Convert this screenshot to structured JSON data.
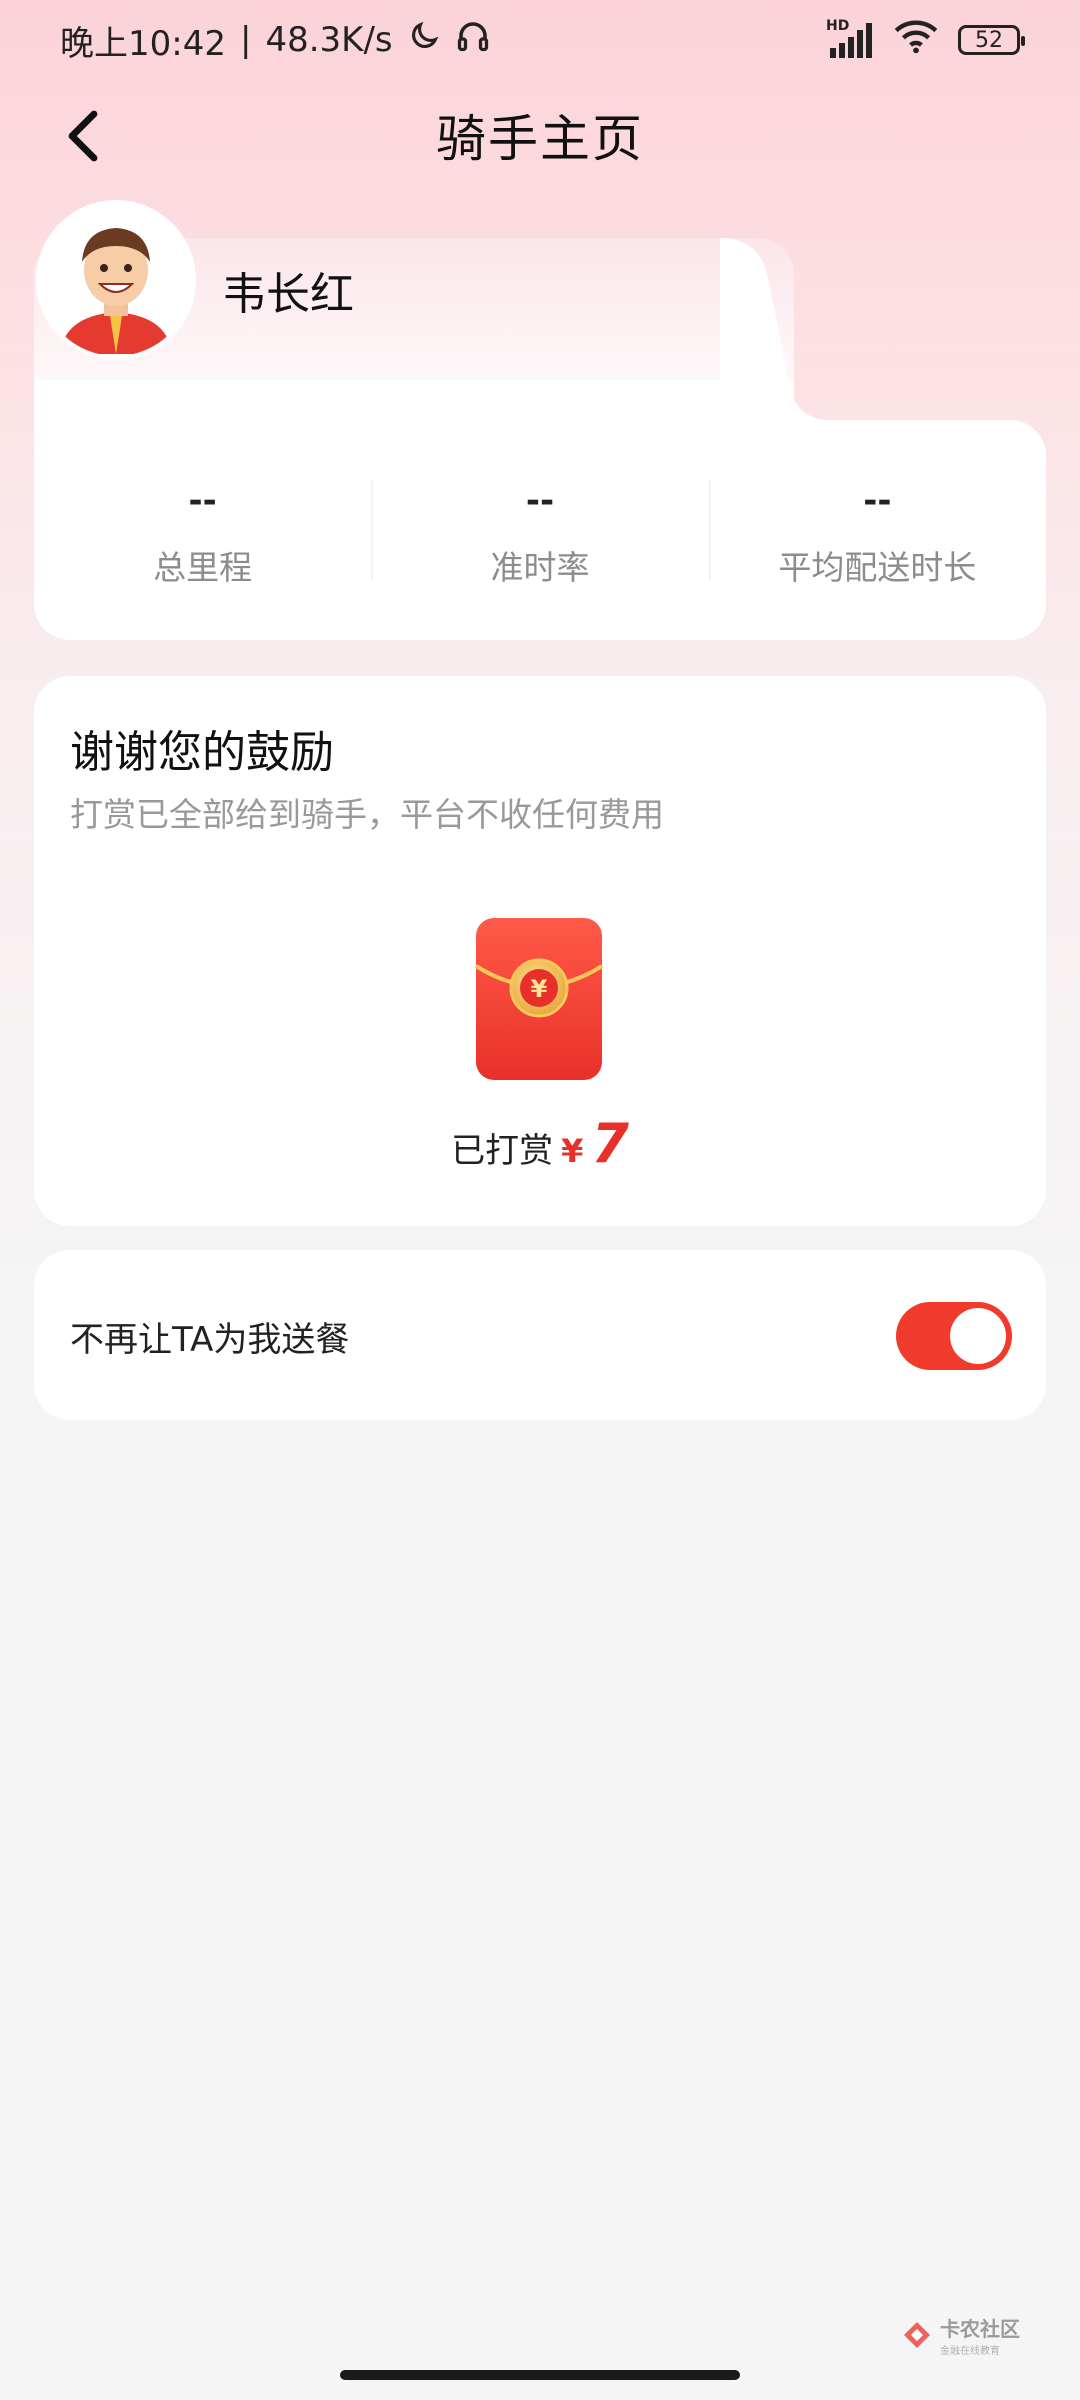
{
  "status_bar": {
    "time": "晚上10:42",
    "separator": "|",
    "net_speed": "48.3K/s",
    "network_label": "HD",
    "battery": "52",
    "icons": [
      "moon-icon",
      "headphones-icon",
      "signal-icon",
      "wifi-icon",
      "battery-icon"
    ]
  },
  "nav": {
    "title": "骑手主页",
    "back_icon": "chevron-left-icon"
  },
  "rider": {
    "name": "韦长红"
  },
  "stats": [
    {
      "value": "--",
      "label": "总里程"
    },
    {
      "value": "--",
      "label": "准时率"
    },
    {
      "value": "--",
      "label": "平均配送时长"
    }
  ],
  "tip": {
    "title": "谢谢您的鼓励",
    "subtitle": "打赏已全部给到骑手，平台不收任何费用",
    "amount_label": "已打赏",
    "currency": "¥",
    "amount": "7"
  },
  "block": {
    "label": "不再让TA为我送餐",
    "enabled": true
  },
  "watermark": {
    "text": "卡农社区",
    "sub": "金融在线教育"
  },
  "colors": {
    "accent": "#e8302a",
    "toggle_on": "#f03a2c",
    "header_pink": "#fbd3d8"
  }
}
